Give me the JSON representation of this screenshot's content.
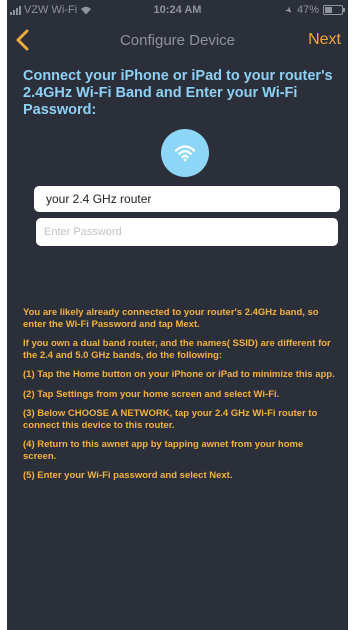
{
  "status_bar": {
    "carrier": "VZW Wi-Fi",
    "time": "10:24 AM",
    "battery": "47%",
    "battery_level": 0.47
  },
  "nav": {
    "back_icon": "chevron-left-icon",
    "title": "Configure Device",
    "next_label": "Next"
  },
  "heading": "Connect your iPhone or iPad to your router's 2.4GHz Wi-Fi Band and Enter your Wi-Fi Password:",
  "wifi_icon": "wifi-icon",
  "form": {
    "ssid_value": "your 2.4 GHz router",
    "password_placeholder": "Enter Password"
  },
  "instructions": [
    "You are likely already connected to your router's 2.4GHz band, so enter the Wi-Fi Password and tap Mext.",
    "If you own a dual band router, and the names( SSID) are different for the 2.4 and 5.0 GHz bands, do the following:",
    "(1) Tap the Home button on your iPhone or iPad to minimize this app.",
    "(2) Tap Settings from your home screen and select Wi-Fi.",
    "(3) Below CHOOSE A NETWORK, tap your 2.4 GHz Wi-Fi router to connect this device to this router.",
    "(4) Return to this awnet app by tapping awnet from your home screen.",
    "(5) Enter your Wi-Fi password and select Next."
  ],
  "colors": {
    "background": "#2b2f3a",
    "heading": "#8fd1f5",
    "instructions": "#f2b13f",
    "accent": "#f2a83b",
    "badge": "#8ed6f7"
  }
}
